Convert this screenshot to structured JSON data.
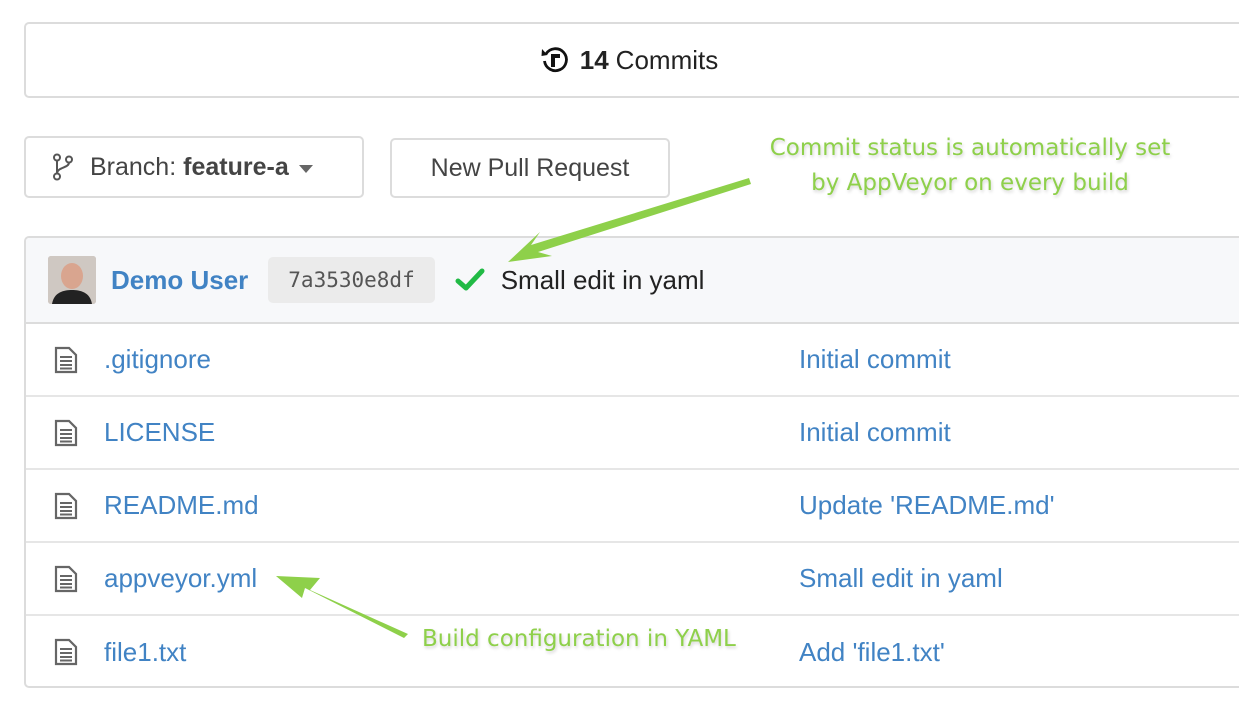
{
  "commits_bar": {
    "count": "14",
    "label": "Commits",
    "icon": "history-icon"
  },
  "toolbar": {
    "branch_label": "Branch:",
    "branch_value": "feature-a",
    "branch_icon": "git-branch-icon",
    "new_pull_request_label": "New Pull Request"
  },
  "latest_commit": {
    "author": "Demo User",
    "sha": "7a3530e8df",
    "status": "success",
    "status_color": "#21ba45",
    "message": "Small edit in yaml"
  },
  "files": [
    {
      "name": ".gitignore",
      "last_commit": "Initial commit"
    },
    {
      "name": "LICENSE",
      "last_commit": "Initial commit"
    },
    {
      "name": "README.md",
      "last_commit": "Update 'README.md'"
    },
    {
      "name": "appveyor.yml",
      "last_commit": "Small edit in yaml"
    },
    {
      "name": "file1.txt",
      "last_commit": "Add 'file1.txt'"
    }
  ],
  "annotations": {
    "status_note_line1": "Commit status is automatically set",
    "status_note_line2": "by AppVeyor on every build",
    "yaml_note": "Build configuration in YAML",
    "color": "#8ed04a"
  },
  "colors": {
    "link": "#4183c4",
    "border": "#dcdcdc"
  }
}
